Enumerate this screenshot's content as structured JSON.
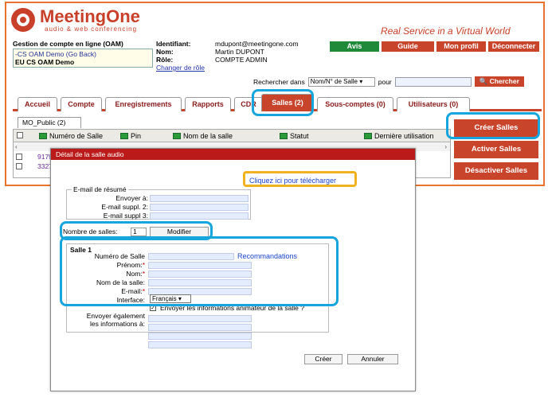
{
  "brand": {
    "name": "MeetingOne",
    "subtitle": "audio & web conferencing",
    "tagline": "Real Service in a Virtual World"
  },
  "account": {
    "title": "Gestion de compte en ligne (OAM)",
    "line1": "-CS OAM Demo (Go Back)",
    "line2": "EU CS OAM Demo"
  },
  "identity": {
    "id_label": "Identifiant:",
    "id_value": "mdupont@meetingone.com",
    "name_label": "Nom:",
    "name_value": "Martin DUPONT",
    "role_label": "Rôle:",
    "role_value": "COMPTE ADMIN",
    "change_role": "Changer de rôle"
  },
  "top_buttons": {
    "avis": "Avis",
    "guide": "Guide",
    "profile": "Mon profil",
    "logout": "Déconnecter"
  },
  "search": {
    "label": "Rechercher dans",
    "field": "Nom/N° de Salle",
    "pour": "pour",
    "button": "Chercher"
  },
  "tabs": [
    "Accueil",
    "Compte",
    "Enregistrements",
    "Rapports",
    "CDR",
    "Salles (2)",
    "Sous-comptes (0)",
    "Utilisateurs (0)"
  ],
  "subtab": "MO_Public (2)",
  "grid": {
    "columns": [
      "Numéro de Salle",
      "Pin",
      "Nom de la salle",
      "Statut",
      "Dernière utilisation"
    ],
    "rows": [
      "9179",
      "3327"
    ]
  },
  "side_buttons": {
    "create": "Créer Salles",
    "activate": "Activer Salles",
    "deactivate": "Désactiver Salles"
  },
  "modal": {
    "title": "Détail de la salle audio",
    "download": "Cliquez ici pour télécharger",
    "email_legend": "E-mail de résumé",
    "send_to": "Envoyer à:",
    "email2": "E-mail suppl. 2:",
    "email3": "E-mail suppl 3:",
    "nb_rooms_label": "Nombre de salles:",
    "nb_rooms_value": "1",
    "modify": "Modifier",
    "room_title": "Salle 1",
    "room_number": "Numéro de Salle",
    "recommendations": "Recommandations",
    "firstname": "Prénom:",
    "lastname": "Nom:",
    "room_name": "Nom de la salle:",
    "email": "E-mail:",
    "interface_label": "Interface:",
    "interface_value": "Français",
    "send_host_info": "Envoyer les informations animateur de la salle ?",
    "also_send_1": "Envoyer également",
    "also_send_2": "les informations à:",
    "create": "Créer",
    "cancel": "Annuler"
  },
  "colors": {
    "accent": "#c8452c",
    "highlight_blue": "#16a5dc",
    "highlight_yellow": "#f0b21e",
    "modal_title": "#bb1a1a"
  }
}
